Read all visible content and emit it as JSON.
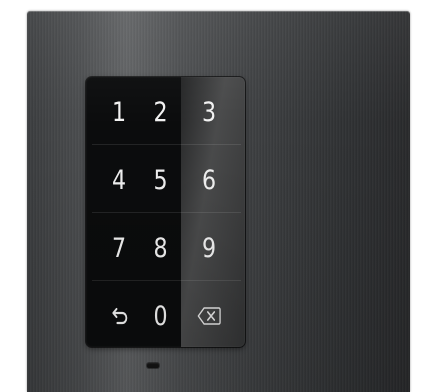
{
  "keypad": {
    "keys": [
      {
        "label": "1",
        "icon": null
      },
      {
        "label": "2",
        "icon": null
      },
      {
        "label": "3",
        "icon": null
      },
      {
        "label": "4",
        "icon": null
      },
      {
        "label": "5",
        "icon": null
      },
      {
        "label": "6",
        "icon": null
      },
      {
        "label": "7",
        "icon": null
      },
      {
        "label": "8",
        "icon": null
      },
      {
        "label": "9",
        "icon": null
      },
      {
        "label": "",
        "icon": "return-arrow-icon"
      },
      {
        "label": "0",
        "icon": null
      },
      {
        "label": "",
        "icon": "backspace-icon"
      }
    ]
  },
  "colors": {
    "panel": "#3f4143",
    "keypad": "#0b0c0d",
    "digit": "#f2f2f2"
  }
}
